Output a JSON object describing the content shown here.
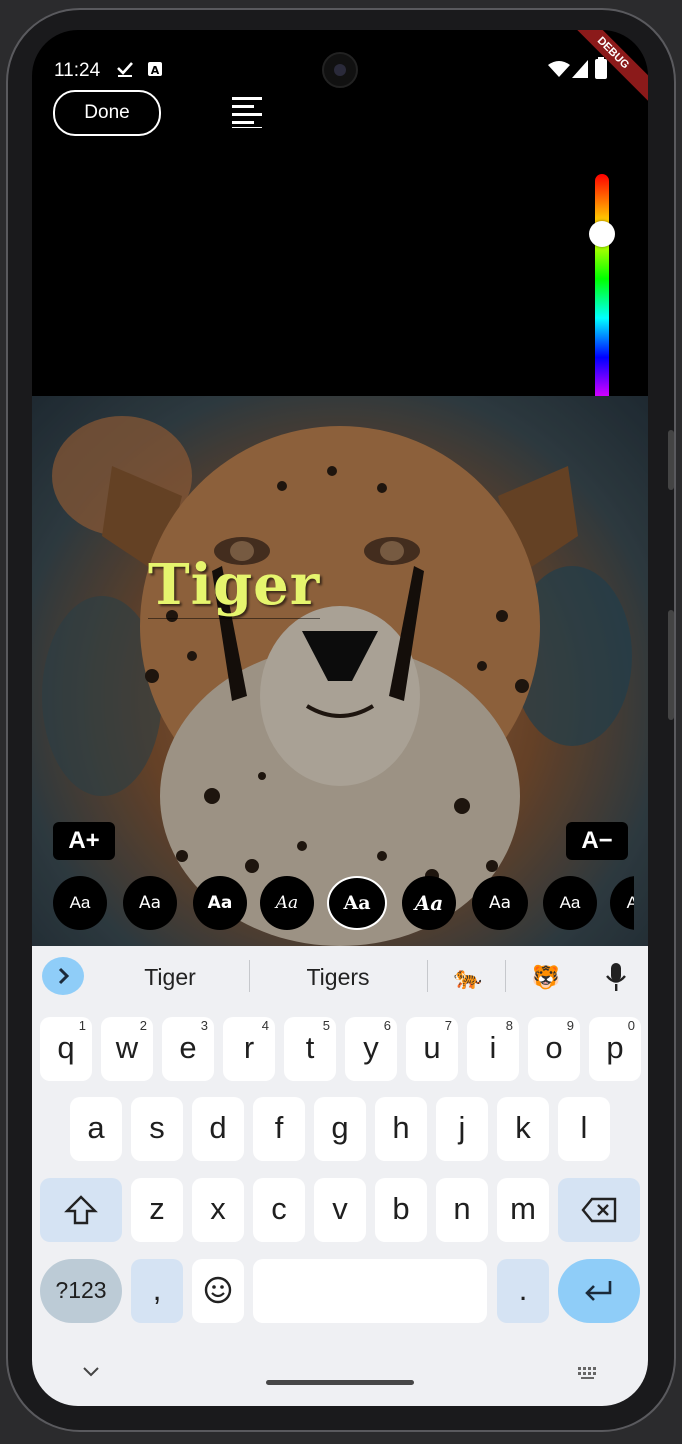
{
  "status": {
    "time": "11:24",
    "debug_banner": "DEBUG"
  },
  "editor": {
    "done_label": "Done",
    "text_overlay": "Tiger",
    "increase_size_label": "A+",
    "decrease_size_label": "A−"
  },
  "font_options": [
    "Aa",
    "Aa",
    "Aa",
    "Aa",
    "Aa",
    "Aa",
    "Aa",
    "Aa",
    "Aa"
  ],
  "font_selected_index": 4,
  "color_slider": {
    "selected_color": "#ffffff"
  },
  "keyboard": {
    "suggestions": [
      "Tiger",
      "Tigers"
    ],
    "emoji_suggestions": [
      "🐅",
      "🐯"
    ],
    "row1": [
      {
        "k": "q",
        "n": "1"
      },
      {
        "k": "w",
        "n": "2"
      },
      {
        "k": "e",
        "n": "3"
      },
      {
        "k": "r",
        "n": "4"
      },
      {
        "k": "t",
        "n": "5"
      },
      {
        "k": "y",
        "n": "6"
      },
      {
        "k": "u",
        "n": "7"
      },
      {
        "k": "i",
        "n": "8"
      },
      {
        "k": "o",
        "n": "9"
      },
      {
        "k": "p",
        "n": "0"
      }
    ],
    "row2": [
      "a",
      "s",
      "d",
      "f",
      "g",
      "h",
      "j",
      "k",
      "l"
    ],
    "row3": [
      "z",
      "x",
      "c",
      "v",
      "b",
      "n",
      "m"
    ],
    "symbols_label": "?123",
    "comma": ",",
    "period": "."
  },
  "colors": {
    "accent": "#8fcdf8",
    "text_overlay": "#e6f56e"
  }
}
